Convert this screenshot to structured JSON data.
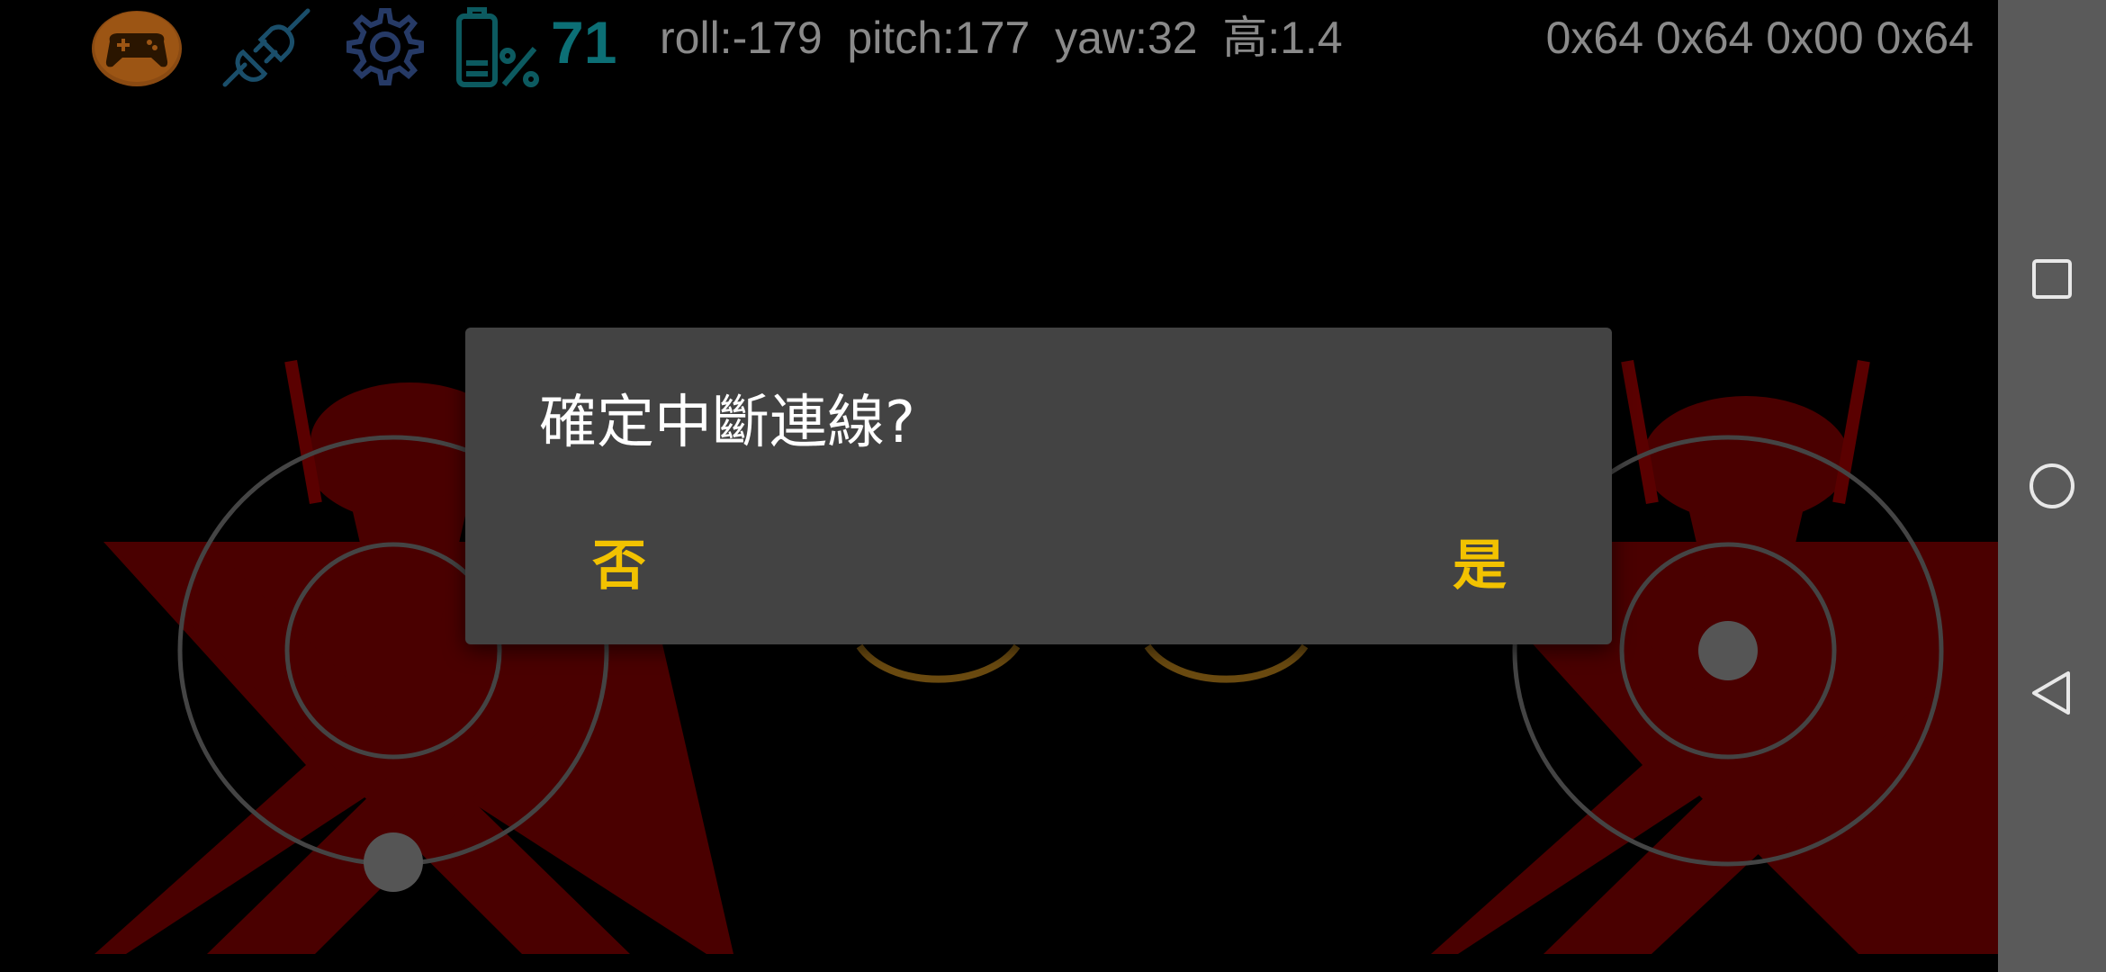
{
  "app": {
    "battery_level": "71",
    "telemetry": "roll:-179  pitch:177  yaw:32  高:1.4",
    "hex_readout": "0x64 0x64 0x00 0x64"
  },
  "icons": {
    "gamepad": "gamepad-icon",
    "connection": "link-icon",
    "settings": "gear-icon",
    "battery": "battery-icon"
  },
  "dialog": {
    "title": "確定中斷連線?",
    "negative_label": "否",
    "positive_label": "是"
  },
  "joysticks": {
    "left": {
      "x": 0.0,
      "y": -1.0
    },
    "right": {
      "x": 0.0,
      "y": 0.0
    }
  },
  "navbar": {
    "items": [
      "recents-icon",
      "home-icon",
      "back-icon"
    ]
  },
  "colors": {
    "background": "#000000",
    "dialog_bg": "#434343",
    "dialog_text": "#ffffff",
    "accent": "#f2c200",
    "battery_text": "#0c6f75",
    "telemetry_text": "#8a8a8a",
    "logo_red": "#4a0000",
    "navbar_bg": "#5a5a5a"
  }
}
